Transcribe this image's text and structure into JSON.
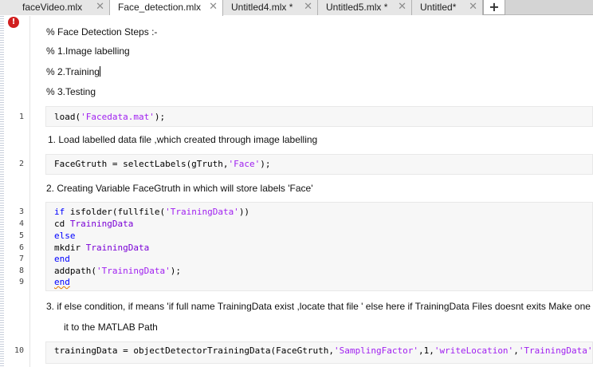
{
  "tabs": [
    {
      "label": "faceVideo.mlx",
      "active": false
    },
    {
      "label": "Face_detection.mlx",
      "active": true
    },
    {
      "label": "Untitled4.mlx *",
      "active": false
    },
    {
      "label": "Untitled5.mlx *",
      "active": false
    },
    {
      "label": "Untitled*",
      "active": false
    }
  ],
  "tab_close_glyph": "✕",
  "add_tab_glyph": "+",
  "error_glyph": "!",
  "text_cells": {
    "heading": "% Face Detection Steps :-",
    "step1": "% 1.Image labelling",
    "step2": "% 2.Training",
    "step3": "% 3.Testing",
    "note1": " 1. Load labelled data file ,which created through image labelling",
    "note2": "2. Creating Variable FaceGtruth in which will store labels 'Face'",
    "note3a": "3. if else condition, if means 'if full name TrainingData exist ,locate that file ' else here if TrainingData Files doesnt exits Make one and",
    "note3b": "it to the MATLAB Path"
  },
  "line_numbers": [
    "1",
    "2",
    "3",
    "4",
    "5",
    "6",
    "7",
    "8",
    "9",
    "10"
  ],
  "code": {
    "l1": {
      "a": "load(",
      "s": "'Facedata.mat'",
      "b": ");"
    },
    "l2": {
      "a": "FaceGtruth = selectLabels(gTruth,",
      "s": "'Face'",
      "b": ");"
    },
    "l3": {
      "kw": "if",
      "a": " isfolder(fullfile(",
      "s": "'TrainingData'",
      "b": "))"
    },
    "l4": {
      "a": "cd ",
      "c": "TrainingData"
    },
    "l5": {
      "kw": "else"
    },
    "l6": {
      "a": "mkdir ",
      "c": "TrainingData"
    },
    "l7": {
      "kw": "end"
    },
    "l8": {
      "a": "addpath(",
      "s": "'TrainingData'",
      "b": ");"
    },
    "l9": {
      "kw": "end"
    },
    "l10": {
      "a": "trainingData = objectDetectorTrainingData(FaceGtruth,",
      "s1": "'SamplingFactor'",
      "b": ",1,",
      "s2": "'writeLocation'",
      "c": ",",
      "s3": "'TrainingData'",
      "d": ");"
    }
  }
}
